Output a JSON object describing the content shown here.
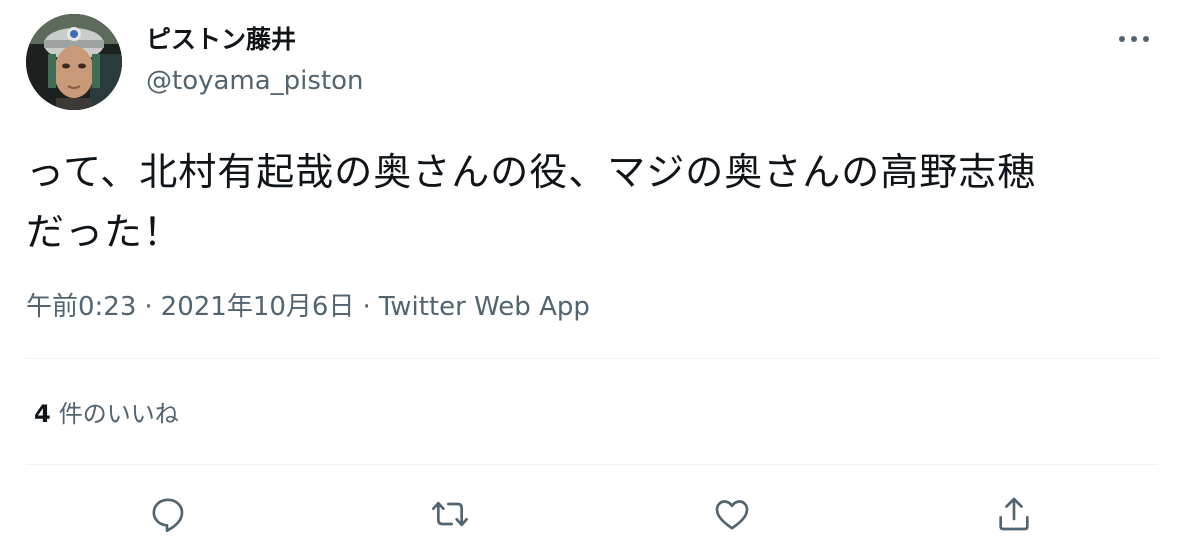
{
  "user": {
    "display_name": "ピストン藤井",
    "handle": "@toyama_piston"
  },
  "tweet": {
    "text": "って、北村有起哉の奥さんの役、マジの奥さんの高野志穂\nだった！",
    "time": "午前0:23",
    "separator": "·",
    "date": "2021年10月6日",
    "source": "Twitter Web App"
  },
  "stats": {
    "likes_count": "4",
    "likes_label": "件のいいね"
  },
  "icons": {
    "more": "more-horizontal-icon",
    "reply": "reply-icon",
    "retweet": "retweet-icon",
    "like": "heart-icon",
    "share": "share-icon"
  },
  "colors": {
    "text": "#0f1419",
    "secondary": "#536471",
    "divider": "#eff3f4"
  }
}
